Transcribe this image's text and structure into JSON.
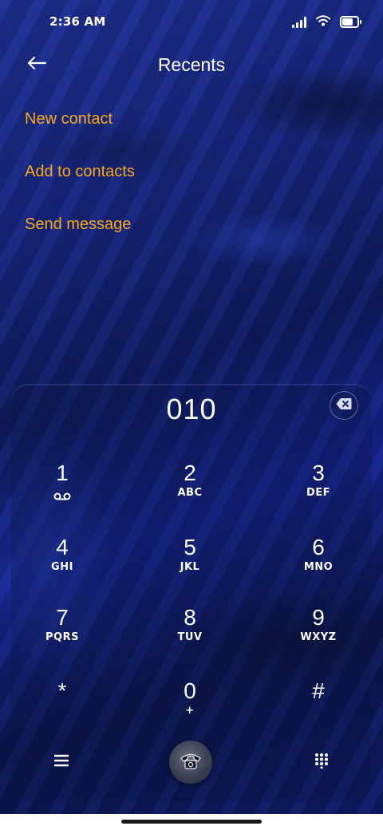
{
  "status_bar": {
    "time": "2:36 AM",
    "icons": [
      "signal-icon",
      "wifi-icon",
      "battery-icon"
    ]
  },
  "header": {
    "back_icon": "arrow-left-icon",
    "title": "Recents"
  },
  "options": [
    {
      "label": "New contact"
    },
    {
      "label": "Add to contacts"
    },
    {
      "label": "Send message"
    }
  ],
  "dialer": {
    "number": "010",
    "delete_icon": "backspace-icon",
    "keys": [
      {
        "digit": "1",
        "letters": "",
        "icon": "voicemail-icon"
      },
      {
        "digit": "2",
        "letters": "ABC"
      },
      {
        "digit": "3",
        "letters": "DEF"
      },
      {
        "digit": "4",
        "letters": "GHI"
      },
      {
        "digit": "5",
        "letters": "JKL"
      },
      {
        "digit": "6",
        "letters": "MNO"
      },
      {
        "digit": "7",
        "letters": "PQRS"
      },
      {
        "digit": "8",
        "letters": "TUV"
      },
      {
        "digit": "9",
        "letters": "WXYZ"
      },
      {
        "digit": "*",
        "letters": ""
      },
      {
        "digit": "0",
        "letters": "+"
      },
      {
        "digit": "#",
        "letters": ""
      }
    ],
    "bottom_icons": [
      "menu-icon",
      "phone-call-icon",
      "dialpad-icon"
    ]
  },
  "colors": {
    "accent": "#f7a81c",
    "text": "#ffffff",
    "background": "#15238a"
  }
}
